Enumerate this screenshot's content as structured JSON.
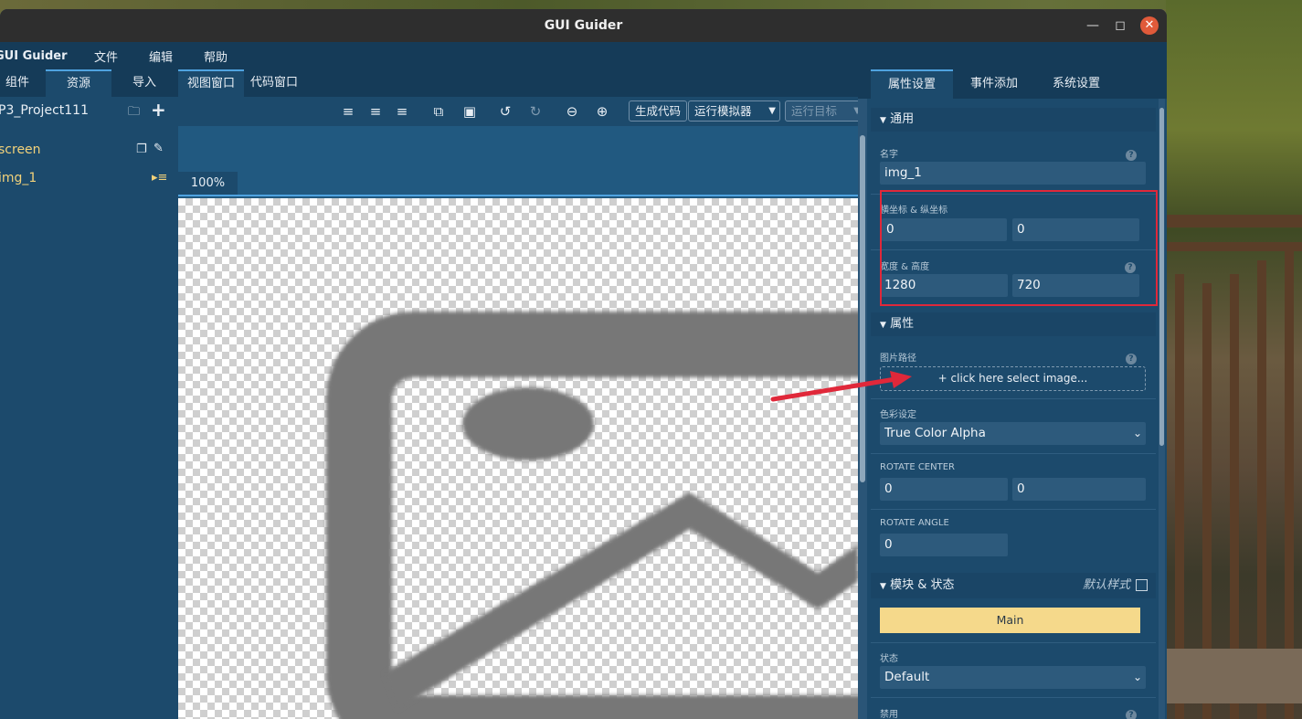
{
  "window": {
    "title": "GUI Guider"
  },
  "menubar": {
    "items": [
      "GUI Guider",
      "文件",
      "编辑",
      "帮助"
    ]
  },
  "left_panel": {
    "tabs": [
      "组件",
      "资源",
      "导入"
    ],
    "project_name": "P3_Project111",
    "tree": [
      {
        "label": "screen"
      },
      {
        "label": "img_1"
      }
    ]
  },
  "center": {
    "tabs": [
      "视图窗口",
      "代码窗口"
    ],
    "toolbar": {
      "generate_code": "生成代码",
      "run_simulator": "运行模拟器",
      "run_target": "运行目标"
    },
    "zoom": "100%"
  },
  "right_panel": {
    "tabs": [
      "属性设置",
      "事件添加",
      "系统设置"
    ],
    "general_section": "通用",
    "name_label": "名字",
    "name_value": "img_1",
    "xy_label": "横坐标 & 纵坐标",
    "x_value": "0",
    "y_value": "0",
    "wh_label": "宽度 & 高度",
    "width_value": "1280",
    "height_value": "720",
    "attributes_section": "属性",
    "image_path_label": "图片路径",
    "image_path_button": "+ click here select image...",
    "color_label": "色彩设定",
    "color_value": "True Color Alpha",
    "rotate_center_label": "ROTATE CENTER",
    "rotate_center_x": "0",
    "rotate_center_y": "0",
    "rotate_angle_label": "ROTATE ANGLE",
    "rotate_angle_value": "0",
    "style_section": "模块 & 状态",
    "default_style_label": "默认样式",
    "main_button": "Main",
    "state_label": "状态",
    "state_value": "Default",
    "disabled_label": "禁用"
  },
  "colors": {
    "accent": "#4fa3e0",
    "highlight_box": "#e0283a",
    "main_button_bg": "#f5d98b"
  }
}
